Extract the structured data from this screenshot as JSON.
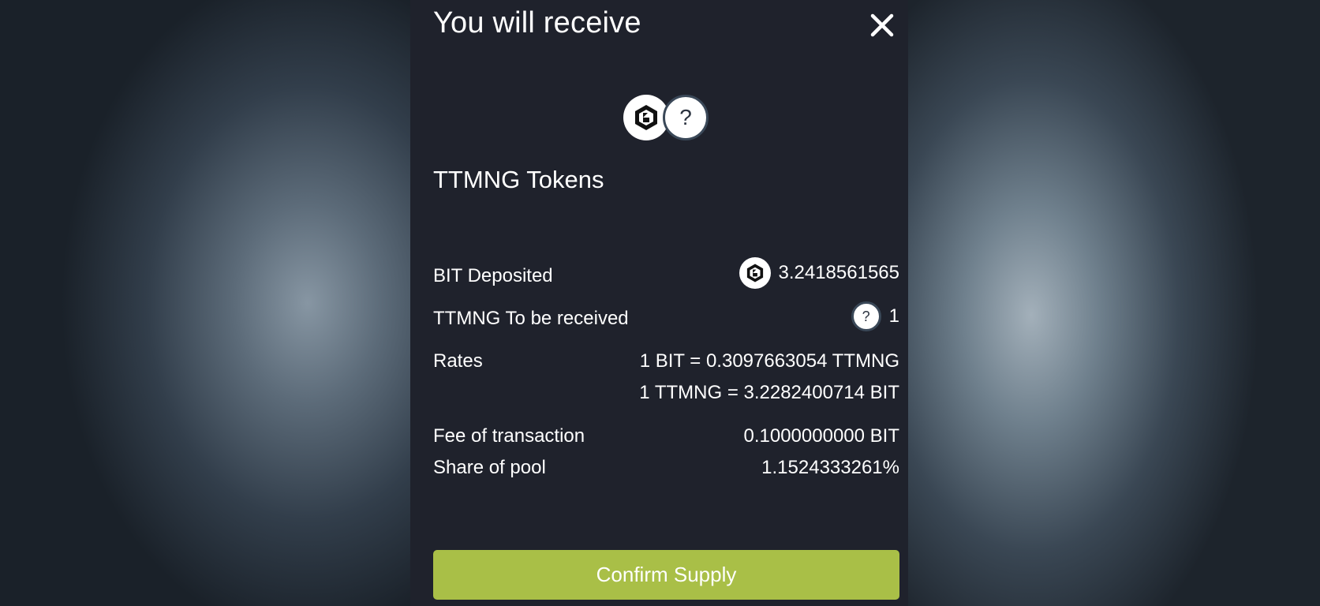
{
  "modal": {
    "title": "You will receive",
    "token_name": "TTMNG Tokens",
    "rows": {
      "deposited": {
        "label": "BIT Deposited",
        "value": "3.2418561565"
      },
      "received": {
        "label": "TTMNG To be received",
        "value": "1"
      },
      "rates": {
        "label": "Rates",
        "value1": "1 BIT = 0.3097663054 TTMNG",
        "value2": "1 TTMNG = 3.2282400714 BIT"
      },
      "fee": {
        "label": "Fee of transaction",
        "value": "0.1000000000 BIT"
      },
      "share": {
        "label": "Share of pool",
        "value": "1.1524333261%"
      }
    },
    "unknown_token_glyph": "?",
    "confirm_label": "Confirm Supply",
    "icons": {
      "close": "close-icon",
      "bit": "bit-token-icon",
      "unknown": "unknown-token-icon"
    },
    "colors": {
      "modal_bg": "#1f222c",
      "confirm_bg": "#a9bf47",
      "text": "#ffffff"
    }
  }
}
